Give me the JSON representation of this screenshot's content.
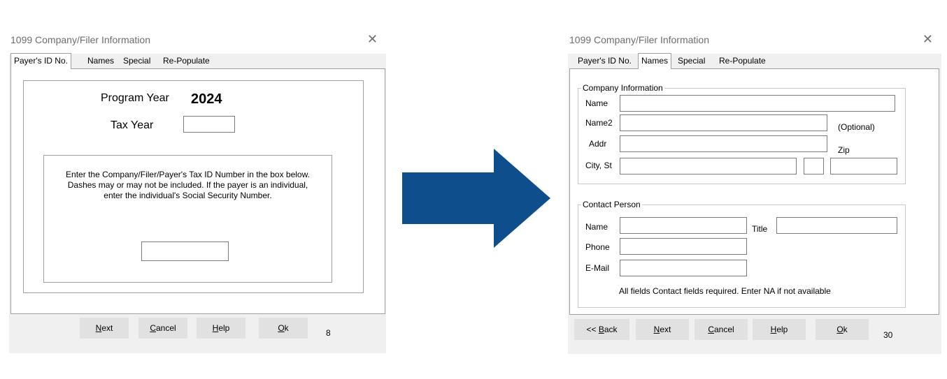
{
  "left_dialog": {
    "title": "1099 Company/Filer Information",
    "close_symbol": "✕",
    "tabs": [
      "Payer's ID No.",
      "Names",
      "Special",
      "Re-Populate"
    ],
    "program_year_label": "Program Year",
    "program_year_value": "2024",
    "tax_year_label": "Tax Year",
    "tax_year_value": "",
    "instructions": "Enter the Company/Filer/Payer's Tax ID Number in the box below. Dashes may or may not be included. If the payer is an individual, enter the individual's Social Security Number.",
    "tax_id_value": "",
    "buttons": {
      "next": "Next",
      "cancel": "Cancel",
      "help": "Help",
      "ok": "Ok"
    },
    "page_number": "8"
  },
  "arrow": {
    "icon": "right-arrow-icon",
    "color": "#0f4e8c"
  },
  "right_dialog": {
    "title": "1099 Company/Filer Information",
    "close_symbol": "✕",
    "tabs": [
      "Payer's ID No.",
      "Names",
      "Special",
      "Re-Populate"
    ],
    "company_group_label": "Company Information",
    "company": {
      "name_label": "Name",
      "name2_label": "Name2",
      "optional_label": "(Optional)",
      "addr_label": "Addr",
      "zip_label": "Zip",
      "city_label": "City, St"
    },
    "contact_group_label": "Contact Person",
    "contact": {
      "name_label": "Name",
      "title_label": "Title",
      "phone_label": "Phone",
      "email_label": "E-Mail",
      "note": "All fields Contact fields required. Enter NA if not available"
    },
    "buttons": {
      "back": "<< Back",
      "next": "Next",
      "cancel": "Cancel",
      "help": "Help",
      "ok": "Ok"
    },
    "page_number": "30"
  }
}
